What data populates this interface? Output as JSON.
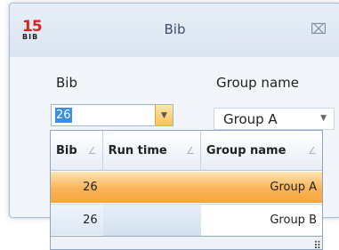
{
  "window": {
    "title": "Bib",
    "icon": {
      "number": "15",
      "text": "BIB"
    },
    "close_glyph": "⌧"
  },
  "form": {
    "bib_label": "Bib",
    "bib_value": "26",
    "group_label": "Group name",
    "group_value": "Group A"
  },
  "grid": {
    "columns": [
      "Bib",
      "Run time",
      "Group name"
    ],
    "rows": [
      {
        "bib": "26",
        "run_time": "",
        "group": "Group A",
        "selected": true
      },
      {
        "bib": "26",
        "run_time": "",
        "group": "Group B",
        "selected": false
      }
    ]
  },
  "colors": {
    "accent_selected_row": "#f7a63c",
    "icon_number": "#e02020",
    "selection_highlight": "#3a8ee6"
  }
}
